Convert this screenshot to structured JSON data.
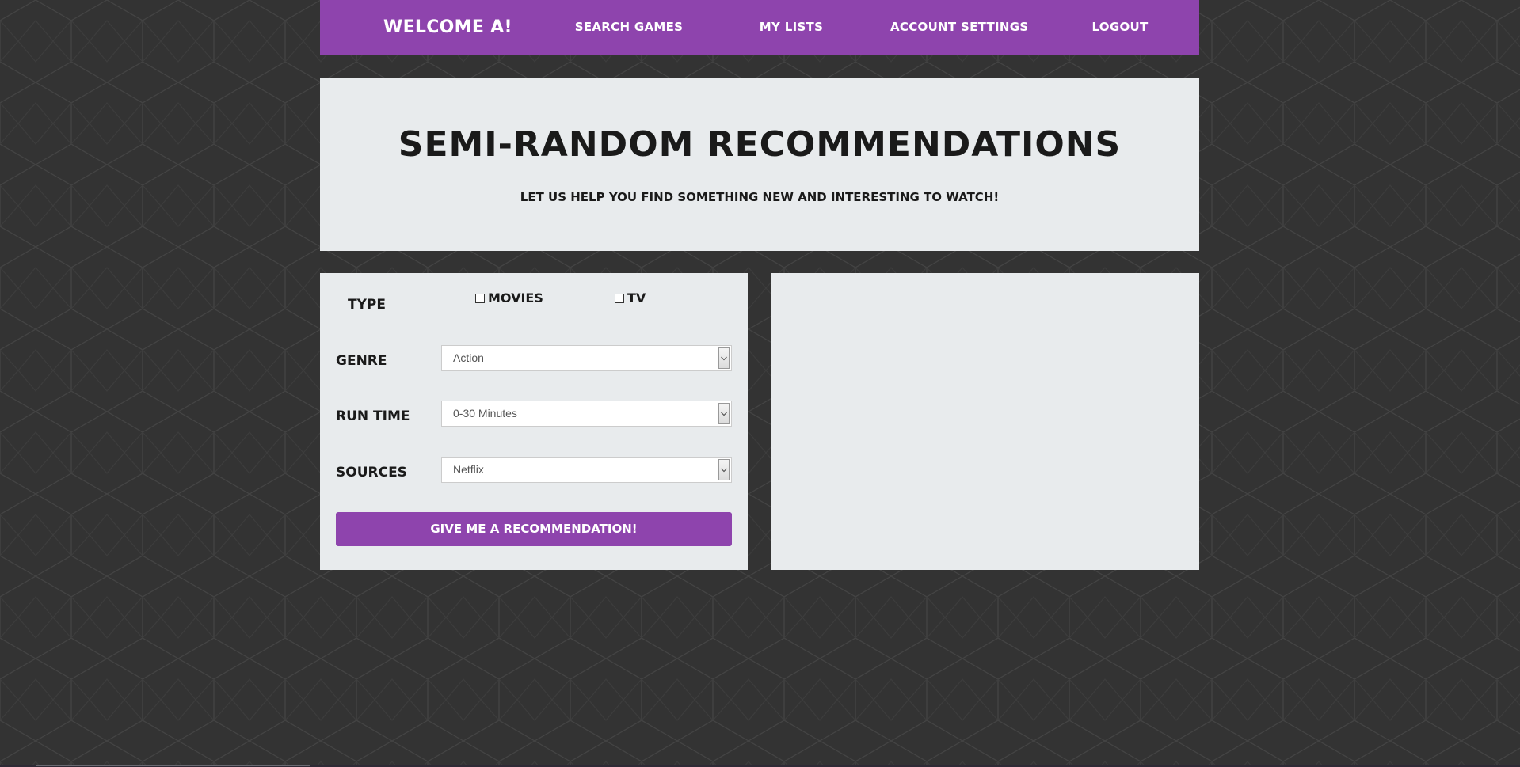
{
  "theme": {
    "accent": "#8e44ad",
    "panel_bg": "#e8ebed",
    "page_bg": "#333333",
    "text_dark": "#1a1a1a"
  },
  "nav": {
    "brand": "WELCOME A!",
    "items": [
      {
        "label": "SEARCH GAMES"
      },
      {
        "label": "MY LISTS"
      },
      {
        "label": "ACCOUNT SETTINGS"
      },
      {
        "label": "LOGOUT"
      }
    ]
  },
  "hero": {
    "title": "SEMI-RANDOM RECOMMENDATIONS",
    "subtitle": "LET US HELP YOU FIND SOMETHING NEW AND INTERESTING TO WATCH!"
  },
  "form": {
    "type_label": "TYPE",
    "type_options": [
      {
        "label": "MOVIES",
        "checked": false
      },
      {
        "label": "TV",
        "checked": false
      }
    ],
    "genre": {
      "label": "GENRE",
      "value": "Action"
    },
    "run_time": {
      "label": "RUN TIME",
      "value": "0-30 Minutes"
    },
    "sources": {
      "label": "SOURCES",
      "value": "Netflix"
    },
    "submit_label": "GIVE ME A RECOMMENDATION!",
    "dropdown_icon": "chevron-down-icon"
  }
}
